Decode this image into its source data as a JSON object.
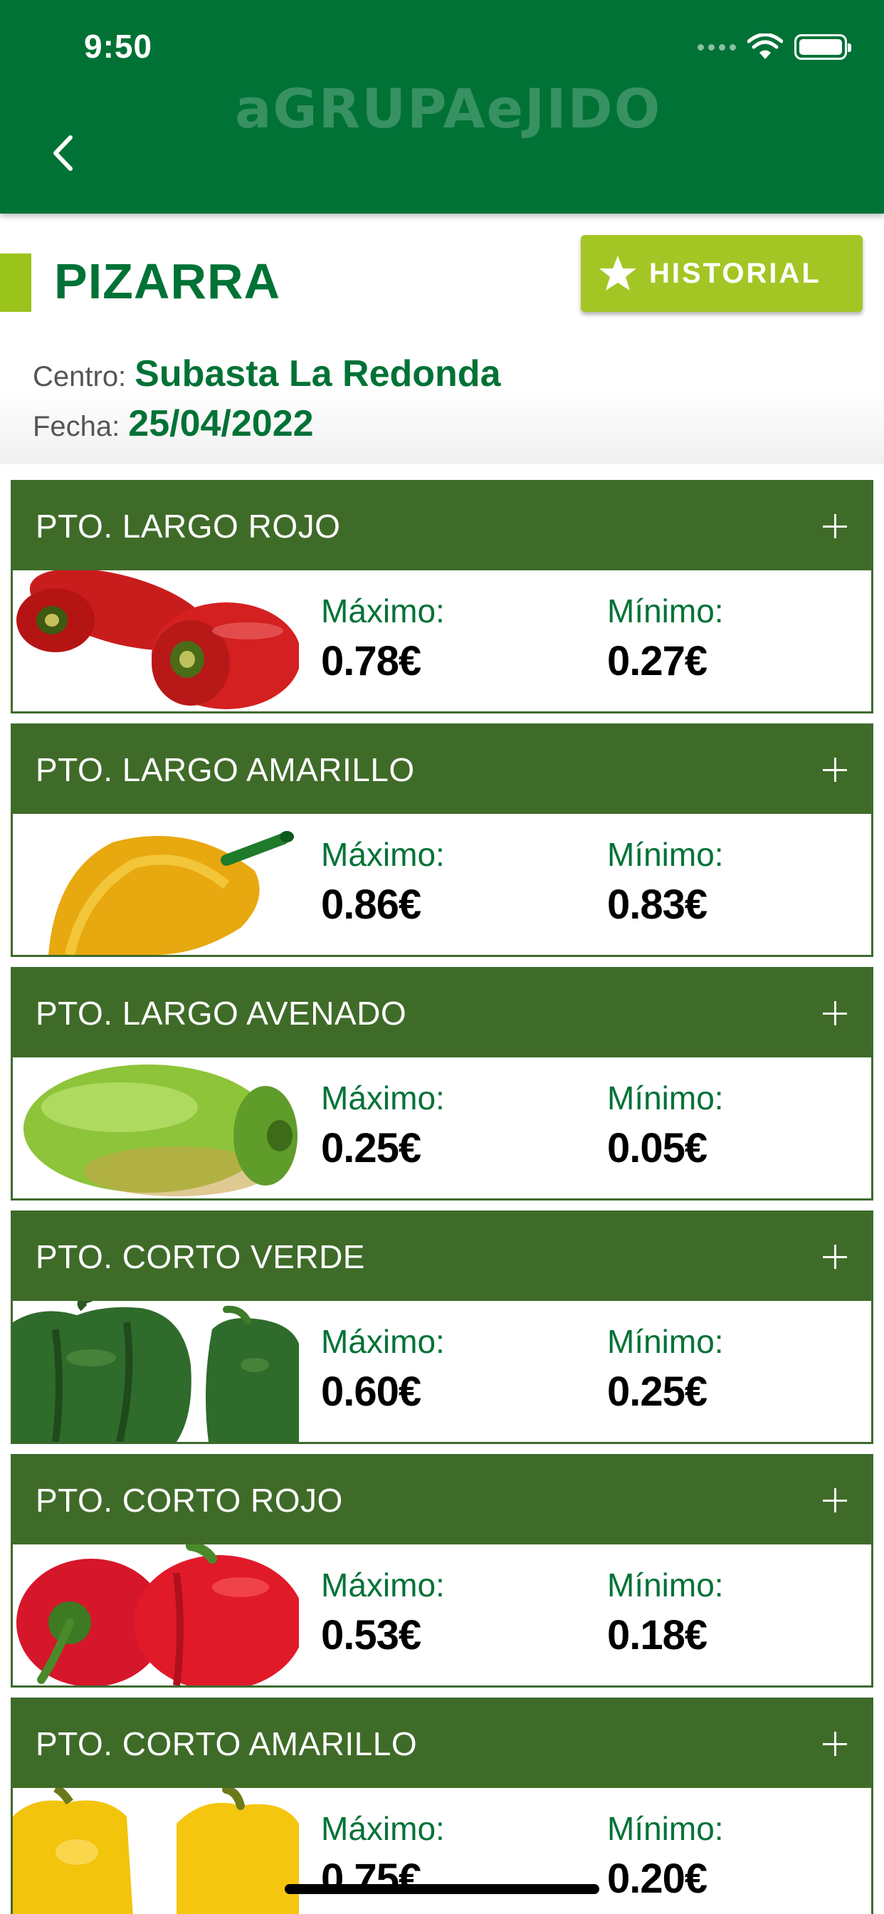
{
  "status_bar": {
    "time": "9:50"
  },
  "header": {
    "logo": "aGRUPAeJIDO"
  },
  "page": {
    "title": "PIZARRA",
    "historial_label": "HISTORIAL",
    "centro_label": "Centro:",
    "centro_value": "Subasta La Redonda",
    "fecha_label": "Fecha:",
    "fecha_value": "25/04/2022"
  },
  "colors": {
    "brand_green": "#007236",
    "card_header_green": "#3f6b28",
    "accent_lime": "#a4c624"
  },
  "products": [
    {
      "name": "PTO. LARGO ROJO",
      "max_label": "Máximo:",
      "max": "0.78€",
      "min_label": "Mínimo:",
      "min": "0.27€"
    },
    {
      "name": "PTO. LARGO AMARILLO",
      "max_label": "Máximo:",
      "max": "0.86€",
      "min_label": "Mínimo:",
      "min": "0.83€"
    },
    {
      "name": "PTO. LARGO AVENADO",
      "max_label": "Máximo:",
      "max": "0.25€",
      "min_label": "Mínimo:",
      "min": "0.05€"
    },
    {
      "name": "PTO. CORTO VERDE",
      "max_label": "Máximo:",
      "max": "0.60€",
      "min_label": "Mínimo:",
      "min": "0.25€"
    },
    {
      "name": "PTO. CORTO ROJO",
      "max_label": "Máximo:",
      "max": "0.53€",
      "min_label": "Mínimo:",
      "min": "0.18€"
    },
    {
      "name": "PTO. CORTO AMARILLO",
      "max_label": "Máximo:",
      "max": "0.75€",
      "min_label": "Mínimo:",
      "min": "0.20€"
    }
  ]
}
